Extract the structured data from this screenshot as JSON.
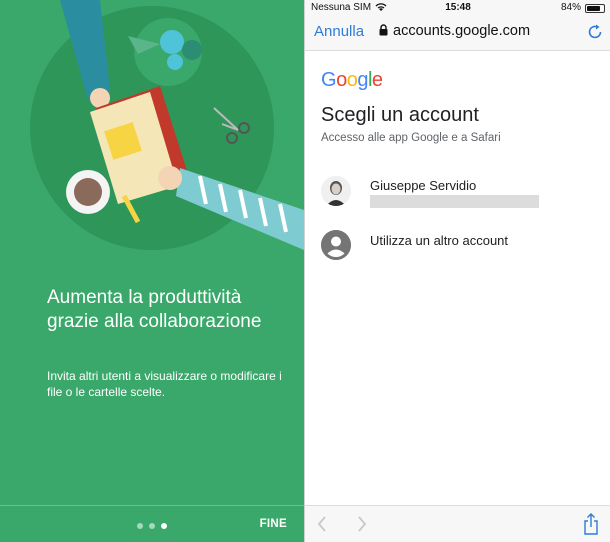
{
  "onboarding": {
    "headline": "Aumenta la produttività grazie alla collaborazione",
    "description": "Invita altri utenti a visualizzare o modificare i file o le cartelle scelte.",
    "pagination": {
      "total": 3,
      "active": 3
    },
    "done_label": "FINE"
  },
  "status_bar": {
    "carrier": "Nessuna SIM",
    "time": "15:48",
    "battery": "84%",
    "battery_level": 0.84
  },
  "browser": {
    "cancel_label": "Annulla",
    "url": "accounts.google.com"
  },
  "signin": {
    "logo_text": "Google",
    "title": "Scegli un account",
    "subtitle": "Accesso alle app Google e a Safari",
    "accounts": [
      {
        "name": "Giuseppe Servidio"
      }
    ],
    "other_account_label": "Utilizza un altro account"
  },
  "colors": {
    "panel_green": "#3aa86a",
    "link_blue": "#2f7bd9",
    "google_blue": "#4285f4",
    "google_red": "#ea4335",
    "google_yellow": "#fbbc05",
    "google_green": "#34a853"
  }
}
